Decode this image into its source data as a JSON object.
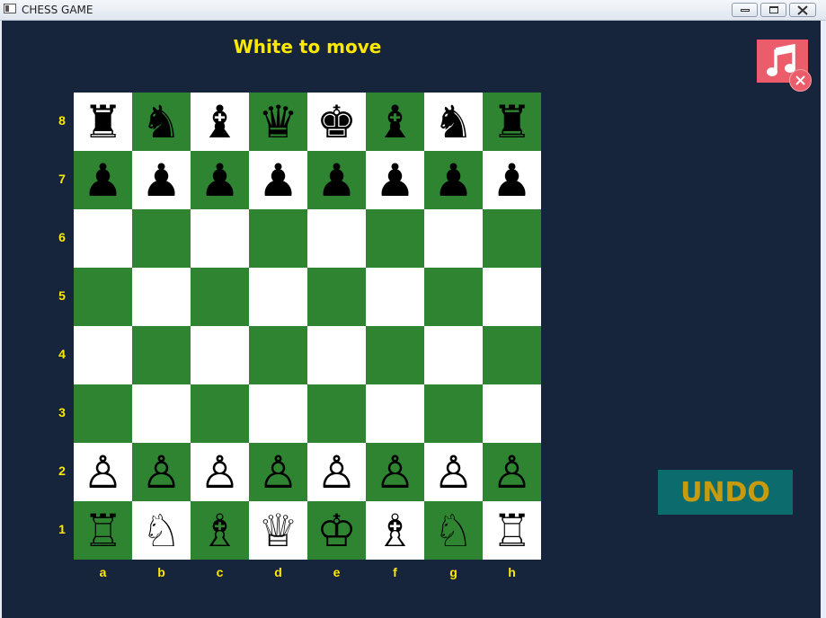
{
  "window": {
    "title": "CHESS GAME"
  },
  "status": "White to move",
  "undo_label": "UNDO",
  "music_icon": "music-note-icon",
  "mute_icon": "close-icon",
  "colors": {
    "background": "#16253b",
    "light_square": "#ffffff",
    "dark_square": "#2e8430",
    "label": "#ffe800",
    "undo_bg": "#0c6c6d",
    "undo_text": "#c79b10",
    "music_bg": "#ec5d6c"
  },
  "board": {
    "files": [
      "a",
      "b",
      "c",
      "d",
      "e",
      "f",
      "g",
      "h"
    ],
    "ranks": [
      "8",
      "7",
      "6",
      "5",
      "4",
      "3",
      "2",
      "1"
    ],
    "rows": [
      [
        "♜",
        "♞",
        "♝",
        "♛",
        "♚",
        "♝",
        "♞",
        "♜"
      ],
      [
        "♟",
        "♟",
        "♟",
        "♟",
        "♟",
        "♟",
        "♟",
        "♟"
      ],
      [
        "",
        "",
        "",
        "",
        "",
        "",
        "",
        ""
      ],
      [
        "",
        "",
        "",
        "",
        "",
        "",
        "",
        ""
      ],
      [
        "",
        "",
        "",
        "",
        "",
        "",
        "",
        ""
      ],
      [
        "",
        "",
        "",
        "",
        "",
        "",
        "",
        ""
      ],
      [
        "♙",
        "♙",
        "♙",
        "♙",
        "♙",
        "♙",
        "♙",
        "♙"
      ],
      [
        "♖",
        "♘",
        "♗",
        "♕",
        "♔",
        "♗",
        "♘",
        "♖"
      ]
    ]
  }
}
